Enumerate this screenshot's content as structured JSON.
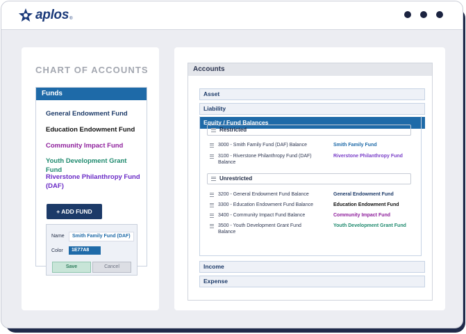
{
  "brand": {
    "name": "aplos",
    "reg": "®"
  },
  "left": {
    "title": "CHART OF ACCOUNTS",
    "funds_header": "Funds",
    "funds": [
      {
        "label": "General Endowment Fund",
        "color": "#1c3a68"
      },
      {
        "label": "Education Endowment Fund",
        "color": "#111111"
      },
      {
        "label": "Community Impact Fund",
        "color": "#8e1f9c"
      },
      {
        "label": "Youth Development Grant Fund",
        "color": "#1f8a6e"
      },
      {
        "label": "Riverstone Philanthropy Fund (DAF)",
        "color": "#6a2bc6"
      }
    ],
    "add_fund": "+ ADD FUND",
    "edit": {
      "name_label": "Name",
      "name_value": "Smith Family Fund (DAF)",
      "color_label": "Color",
      "color_value": "1E77A8",
      "save": "Save",
      "cancel": "Cancel"
    }
  },
  "right": {
    "header": "Accounts",
    "asset": "Asset",
    "liability": "Liability",
    "equity": "Equity / Fund Balances",
    "restricted": "Restricted",
    "restricted_lines": [
      {
        "account": "3000 - Smith Family Fund (DAF) Balance",
        "fund": "Smith Family Fund",
        "color": "#1e6aa8"
      },
      {
        "account": "3100 - Riverstone Philanthropy Fund (DAF) Balance",
        "fund": "Riverstone Philanthropy Fund",
        "color": "#7a3fc8"
      }
    ],
    "unrestricted": "Unrestricted",
    "unrestricted_lines": [
      {
        "account": "3200 - General Endowment Fund Balance",
        "fund": "General Endowment Fund",
        "color": "#1c3a68"
      },
      {
        "account": "3300 - Education Endowment Fund Balance",
        "fund": "Education Endowment Fund",
        "color": "#111111"
      },
      {
        "account": "3400 - Community Impact Fund Balance",
        "fund": "Community Impact Fund",
        "color": "#8e1f9c"
      },
      {
        "account": "3500 - Youth Development Grant Fund Balance",
        "fund": "Youth Development Grant Fund",
        "color": "#1f8a6e"
      }
    ],
    "income": "Income",
    "expense": "Expense"
  }
}
